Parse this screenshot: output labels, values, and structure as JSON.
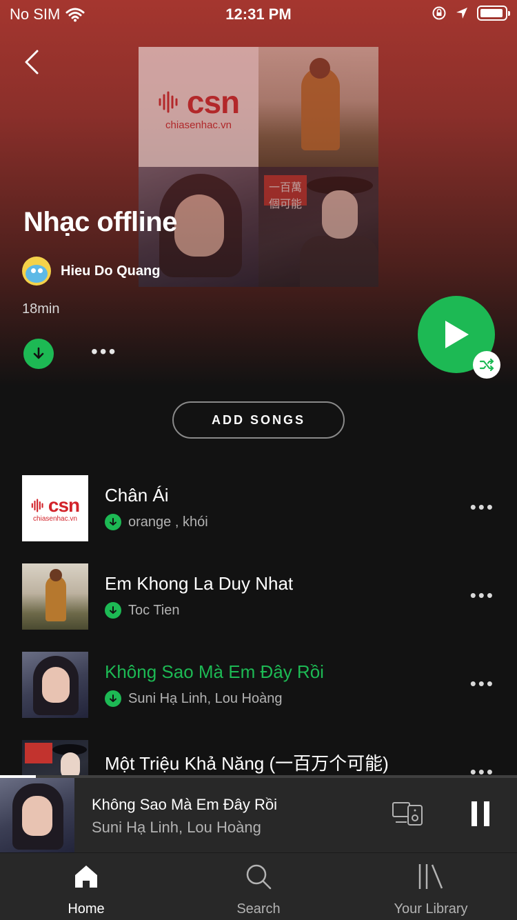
{
  "status_bar": {
    "carrier": "No SIM",
    "time": "12:31 PM"
  },
  "playlist": {
    "title": "Nhạc offline",
    "owner": "Hieu Do Quang",
    "duration": "18min",
    "add_songs_label": "ADD SONGS",
    "cover_texts": {
      "csn_logo": "csn",
      "csn_site": "chiasenhac.vn",
      "badge": "一百萬個可能"
    }
  },
  "tracks": [
    {
      "title": "Chân Ái",
      "artist": "orange , khói",
      "downloaded": true,
      "playing": false,
      "art": "csn"
    },
    {
      "title": "Em Khong La Duy Nhat",
      "artist": "Toc Tien",
      "downloaded": true,
      "playing": false,
      "art": "coat"
    },
    {
      "title": "Không Sao Mà Em Đây Rồi",
      "artist": "Suni Hạ Linh,  Lou Hoàng",
      "downloaded": true,
      "playing": true,
      "art": "girl"
    },
    {
      "title": "Một Triệu Khả Năng (一百万个可能)",
      "artist": "",
      "downloaded": false,
      "playing": false,
      "art": "hat"
    }
  ],
  "now_playing": {
    "title": "Không Sao Mà Em Đây Rồi",
    "artist": "Suni Hạ Linh,  Lou Hoàng",
    "progress": 0.07
  },
  "tab_bar": {
    "home": "Home",
    "search": "Search",
    "library": "Your Library",
    "active": "home"
  },
  "colors": {
    "accent": "#1db954",
    "background": "#121212",
    "hero": "#a5362f",
    "bar": "#282828"
  },
  "icons": [
    "back-icon",
    "wifi-icon",
    "lock-rotation-icon",
    "location-icon",
    "battery-icon",
    "download-icon",
    "more-icon",
    "play-icon",
    "shuffle-icon",
    "devices-icon",
    "pause-icon",
    "home-icon",
    "search-icon",
    "library-icon"
  ]
}
